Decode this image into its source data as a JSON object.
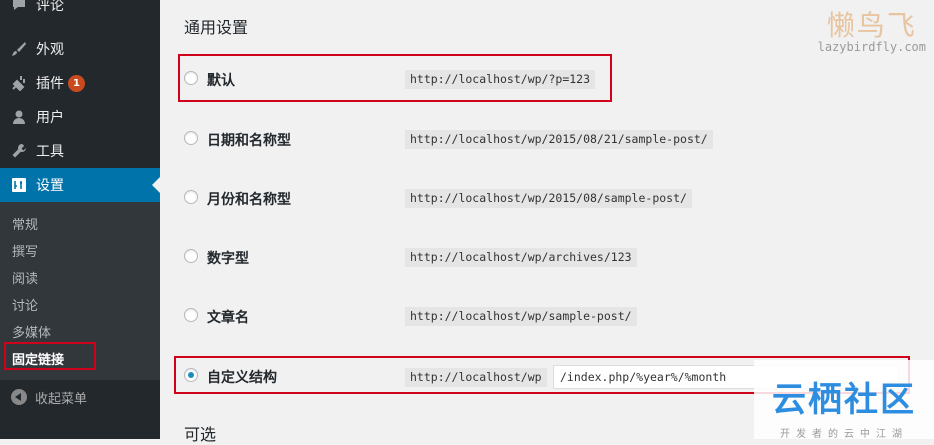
{
  "sidebar": {
    "items": [
      {
        "label": "评论",
        "icon": "comment-icon"
      },
      {
        "label": "外观",
        "icon": "paintbrush-icon"
      },
      {
        "label": "插件",
        "icon": "plugin-icon",
        "badge": "1"
      },
      {
        "label": "用户",
        "icon": "user-icon"
      },
      {
        "label": "工具",
        "icon": "wrench-icon"
      },
      {
        "label": "设置",
        "icon": "settings-icon"
      }
    ],
    "submenu": [
      "常规",
      "撰写",
      "阅读",
      "讨论",
      "多媒体",
      "固定链接"
    ],
    "collapse_label": "收起菜单",
    "accent_color": "#0073aa"
  },
  "main": {
    "section_title": "通用设置",
    "options": [
      {
        "label": "默认",
        "example": "http://localhost/wp/?p=123",
        "checked": false
      },
      {
        "label": "日期和名称型",
        "example": "http://localhost/wp/2015/08/21/sample-post/",
        "checked": false
      },
      {
        "label": "月份和名称型",
        "example": "http://localhost/wp/2015/08/sample-post/",
        "checked": false
      },
      {
        "label": "数字型",
        "example": "http://localhost/wp/archives/123",
        "checked": false
      },
      {
        "label": "文章名",
        "example": "http://localhost/wp/sample-post/",
        "checked": false
      },
      {
        "label": "自定义结构",
        "example": "http://localhost/wp",
        "checked": true
      }
    ],
    "custom_structure_value": "/index.php/%year%/%month",
    "optional_title": "可选"
  },
  "watermarks": {
    "top_brand": "懒鸟飞",
    "top_url": "lazybirdfly.com",
    "bottom_brand": "云栖社区",
    "bottom_tagline": "开发者的云中江湖"
  }
}
